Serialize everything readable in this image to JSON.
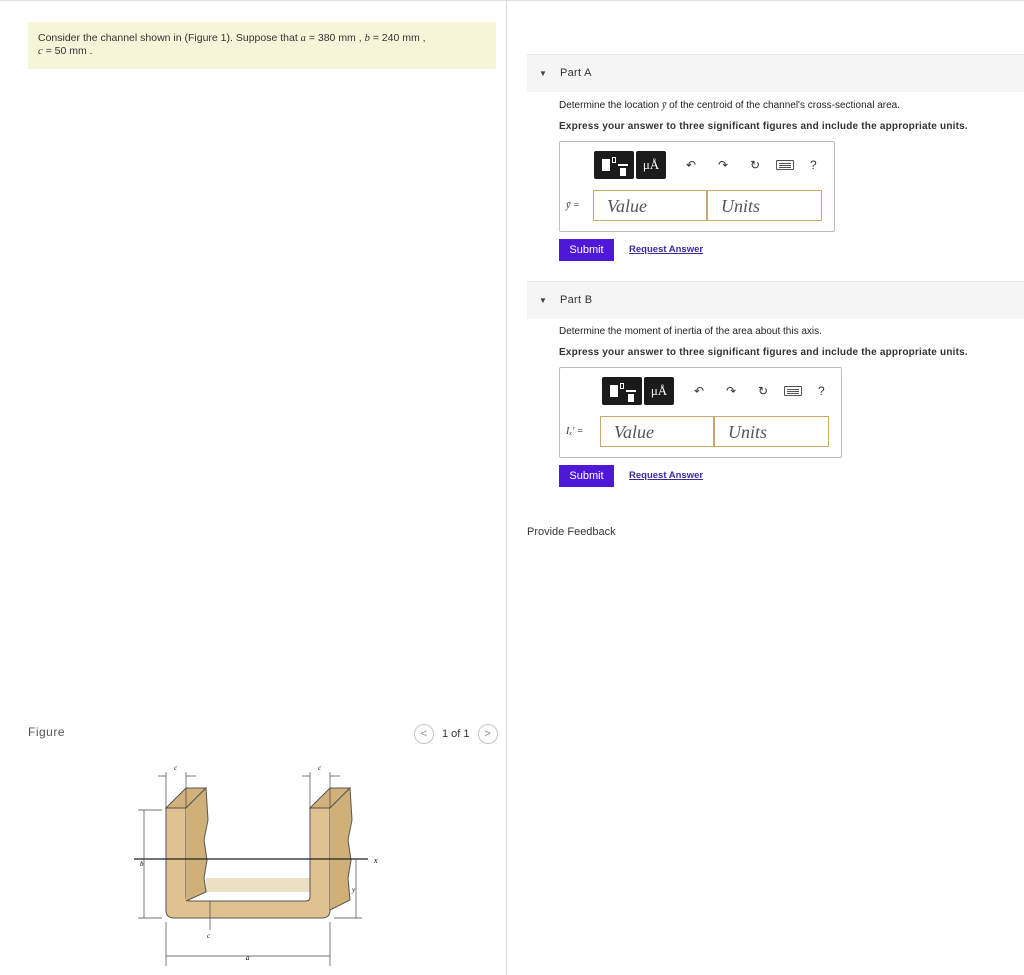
{
  "problem": {
    "text_before": "Consider the channel shown in (Figure 1). Suppose that ",
    "a_var": "a",
    "a_eq": " = 380 ",
    "unit": "mm",
    "sep1": " , ",
    "b_var": "b",
    "b_eq": " = 240 ",
    "sep2": " ,",
    "c_var": "c",
    "c_eq": " = 50 ",
    "end": " ."
  },
  "figure": {
    "title": "Figure",
    "pager": {
      "prev": "<",
      "count": "1 of 1",
      "next": ">"
    },
    "labels": {
      "c": "c",
      "b": "b",
      "a": "a",
      "x": "x",
      "y": "y"
    }
  },
  "partA": {
    "toggle": "▼",
    "title": "Part A",
    "question_pre": "Determine the location ",
    "question_var": "ȳ",
    "question_post": " of the centroid of the channel's cross-sectional area.",
    "instruction": "Express your answer to three significant figures and include the appropriate units.",
    "var_label": "ȳ =",
    "value_placeholder": "Value",
    "units_placeholder": "Units",
    "submit": "Submit",
    "request": "Request Answer"
  },
  "partB": {
    "toggle": "▼",
    "title": "Part B",
    "question": "Determine the moment of inertia of the area about this axis.",
    "instruction": "Express your answer to three significant figures and include the appropriate units.",
    "var_label": "Iₓ' =",
    "value_placeholder": "Value",
    "units_placeholder": "Units",
    "submit": "Submit",
    "request": "Request Answer"
  },
  "toolbar": {
    "mu_label": "μÅ",
    "undo": "↶",
    "redo": "↷",
    "reset": "↻",
    "help": "?"
  },
  "feedback": "Provide Feedback",
  "colors": {
    "statement_bg": "#f6f5da",
    "submit_bg": "#4f18d9",
    "field_border": "#c9a66b",
    "channel_fill": "#dfc28f"
  }
}
